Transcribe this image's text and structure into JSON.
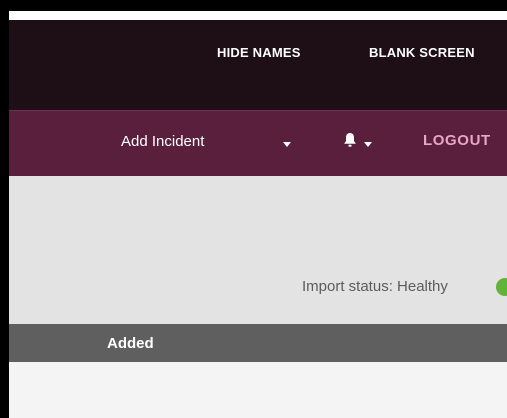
{
  "top_bar": {
    "hide_names": "HIDE NAMES",
    "blank_screen": "BLANK SCREEN"
  },
  "nav": {
    "add_incident": "Add Incident",
    "logout": "LOGOUT",
    "icons": [
      "chevron-down-icon",
      "bell-icon",
      "chevron-down-icon"
    ]
  },
  "status": {
    "import_status": "Import status: Healthy",
    "indicator_color": "#62b33a"
  },
  "table": {
    "columns": [
      "Added"
    ]
  },
  "colors": {
    "top_bar": "#1e0e16",
    "nav_bar": "#5a1f3d",
    "logout_text": "#e8a5c5",
    "status_bg": "#e3e3e3",
    "table_header": "#5f5f5f"
  }
}
